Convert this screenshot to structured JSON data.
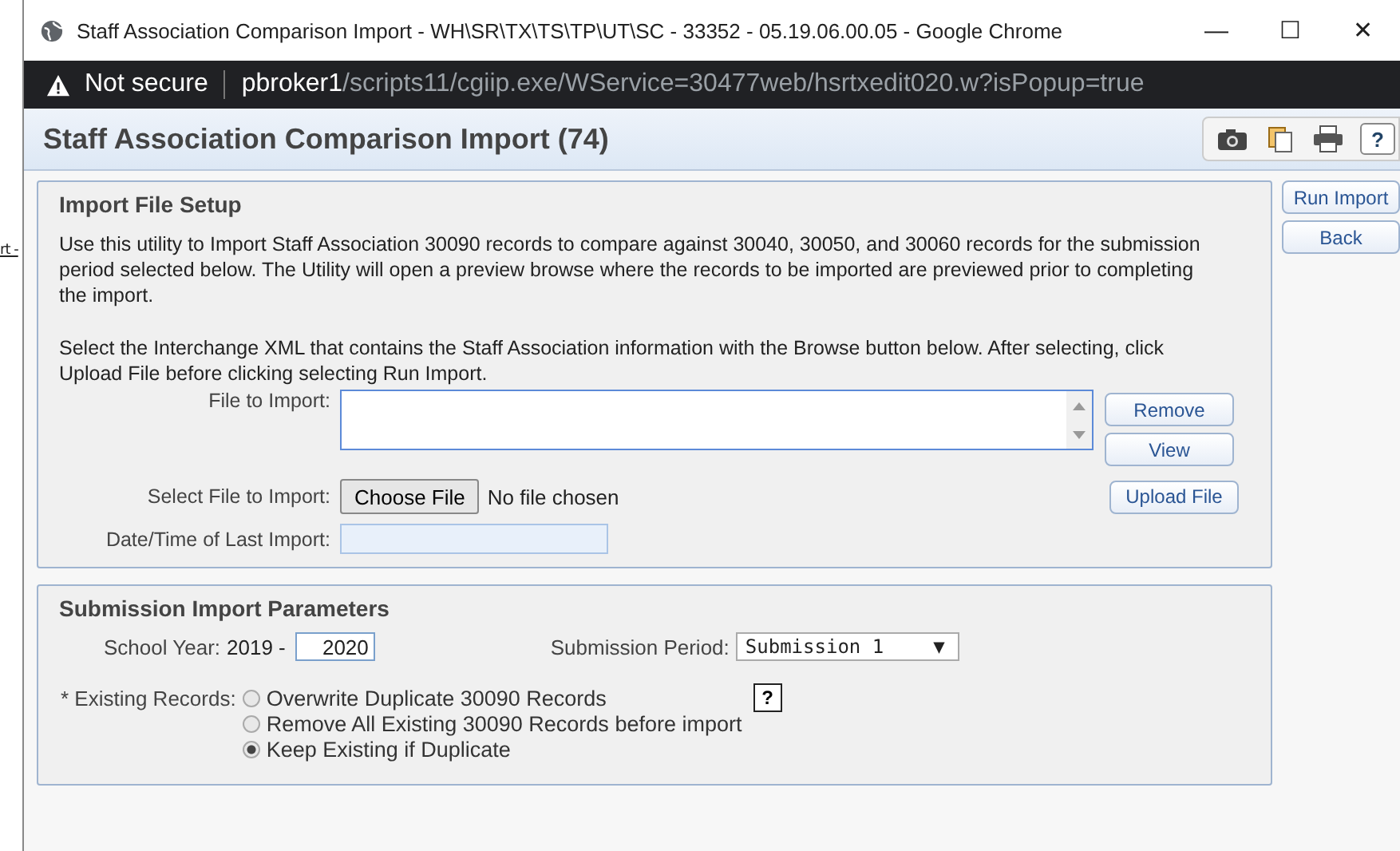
{
  "background_page": {
    "link_text": "rt -"
  },
  "window": {
    "title": "Staff Association Comparison Import - WH\\SR\\TX\\TS\\TP\\UT\\SC - 33352 - 05.19.06.00.05 - Google Chrome",
    "controls": [
      "—",
      "☐",
      "✕"
    ]
  },
  "address_bar": {
    "security": "Not secure",
    "host": "pbroker1",
    "path": "/scripts11/cgiip.exe/WService=30477web/hsrtxedit020.w?isPopup=true"
  },
  "page": {
    "title": "Staff Association Comparison Import (74)",
    "toolbar": [
      {
        "kind": "camera"
      },
      {
        "kind": "copy"
      },
      {
        "kind": "print"
      },
      {
        "kind": "help",
        "label": "?"
      }
    ]
  },
  "side_buttons": [
    "Run Import",
    "Back"
  ],
  "import_setup": {
    "heading": "Import File Setup",
    "description": "Use this utility to Import Staff Association 30090 records to compare against 30040, 30050, and 30060 records for the submission period selected below. The Utility will open a preview browse where the records to be imported are previewed prior to completing the import.",
    "instructions": "Select the Interchange XML that contains the Staff Association information with the Browse button below. After selecting, click Upload File before clicking selecting Run Import.",
    "file_label": "File to Import:",
    "file_buttons": [
      "Remove",
      "View"
    ],
    "select_label": "Select File to Import:",
    "choose_button": "Choose File",
    "no_file": "No file chosen",
    "upload_button": "Upload File",
    "last_import_label": "Date/Time of Last Import:"
  },
  "parameters": {
    "heading": "Submission Import Parameters",
    "year_label": "School Year:",
    "year_start": "2019 -",
    "year_end": "2020",
    "period_label": "Submission Period:",
    "period_value": "Submission 1",
    "period_caret": "▼",
    "existing_label": "* Existing Records:",
    "help": "?",
    "options": [
      {
        "label": "Overwrite Duplicate 30090 Records",
        "selected": false
      },
      {
        "label": "Remove All Existing 30090 Records before import",
        "selected": false
      },
      {
        "label": "Keep Existing if Duplicate",
        "selected": true
      }
    ]
  }
}
